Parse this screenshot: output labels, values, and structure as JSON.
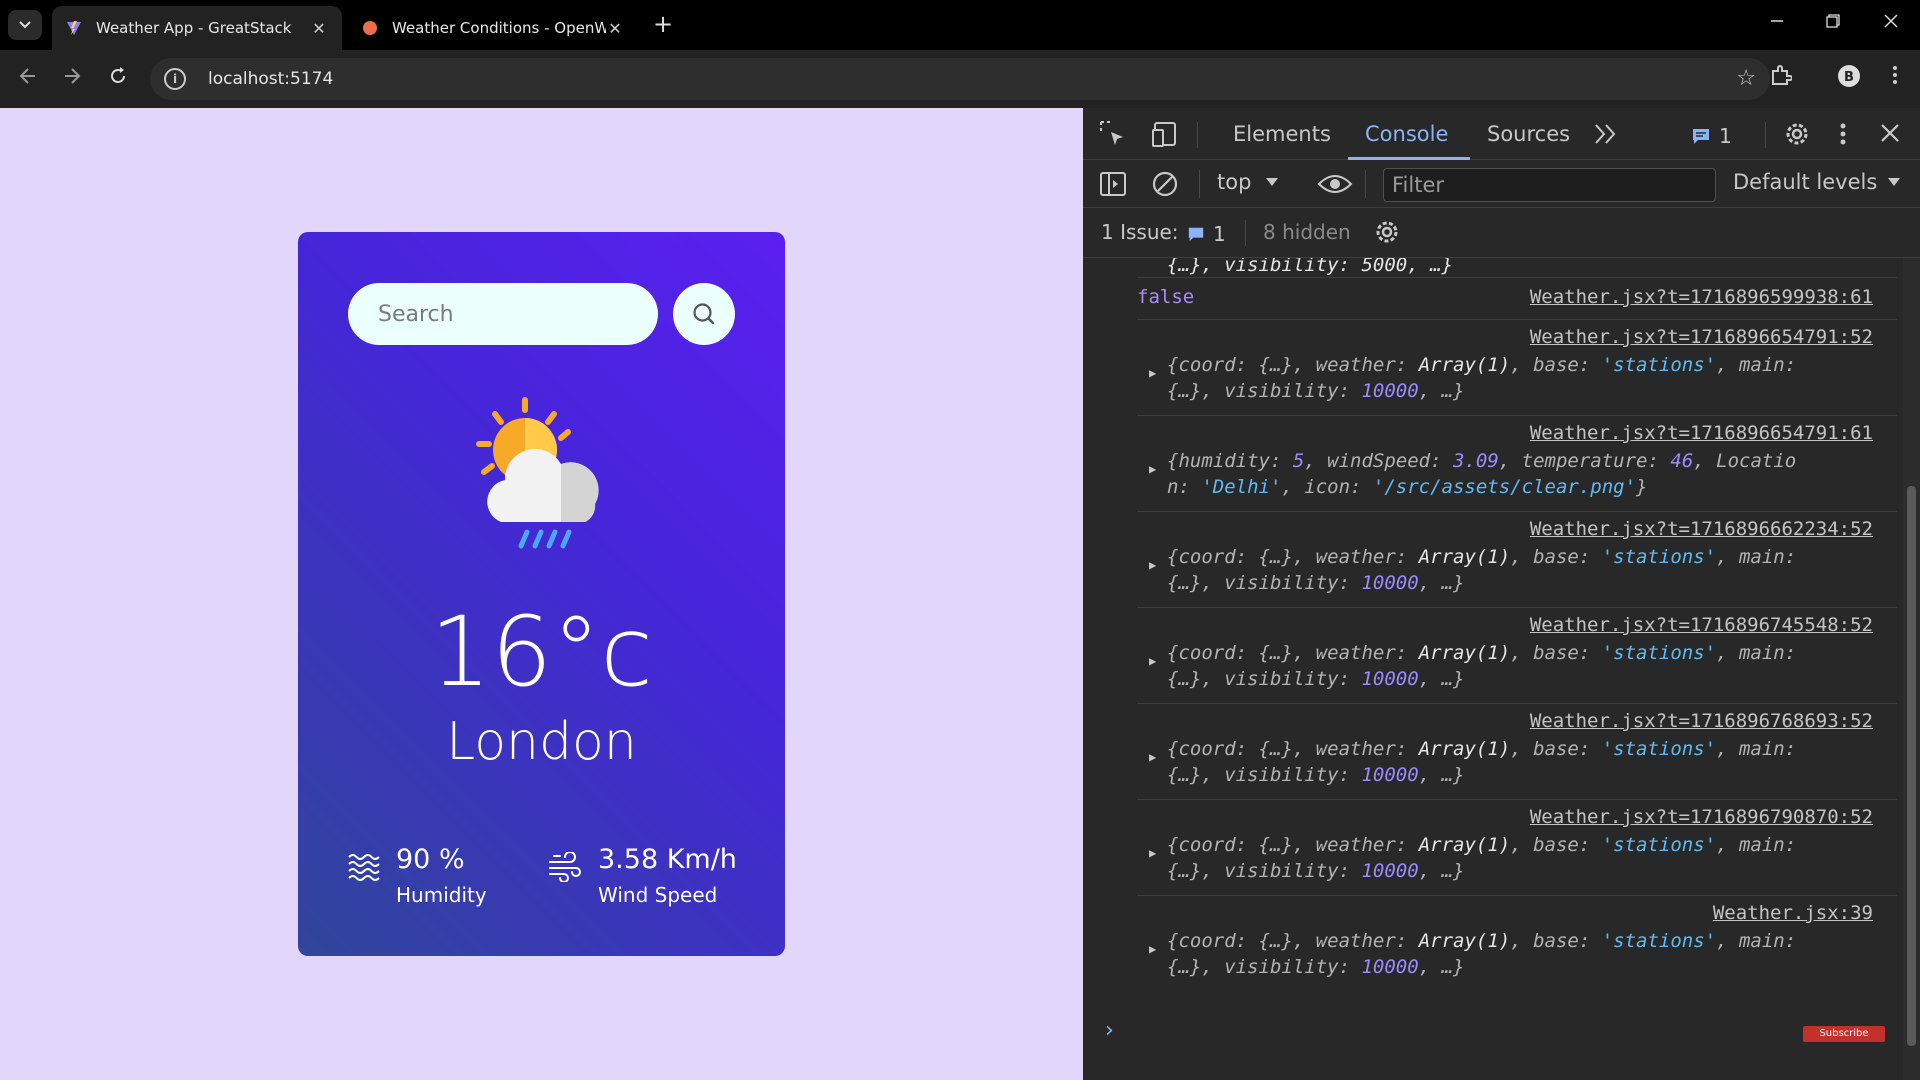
{
  "browser": {
    "tabs": [
      {
        "title": "Weather App - GreatStack",
        "active": true
      },
      {
        "title": "Weather Conditions - OpenWea",
        "active": false
      }
    ],
    "url": "localhost:5174",
    "tab_close": "✕",
    "new_tab": "+"
  },
  "app": {
    "search_placeholder": "Search",
    "temperature": "16°c",
    "city": "London",
    "humidity_value": "90 %",
    "humidity_label": "Humidity",
    "wind_value": "3.58 Km/h",
    "wind_label": "Wind Speed",
    "weather_icon": "partly-cloudy-rain-icon"
  },
  "devtools": {
    "tabs": [
      "Elements",
      "Console",
      "Sources"
    ],
    "active_tab": "Console",
    "messages_badge": "1",
    "context": "top",
    "filter_placeholder": "Filter",
    "levels": "Default levels",
    "issues_label": "1 Issue:",
    "issues_count": "1",
    "hidden_label": "8 hidden",
    "console": {
      "top_partial": "{…}, visibility: 5000, …}",
      "false_value": "false",
      "false_source": "Weather.jsx?t=1716896599938:61",
      "entries": [
        {
          "source": "Weather.jsx?t=1716896654791:52",
          "type": "obj"
        },
        {
          "source": "Weather.jsx?t=1716896654791:61",
          "type": "data"
        },
        {
          "source": "Weather.jsx?t=1716896662234:52",
          "type": "obj"
        },
        {
          "source": "Weather.jsx?t=1716896745548:52",
          "type": "obj"
        },
        {
          "source": "Weather.jsx?t=1716896768693:52",
          "type": "obj"
        },
        {
          "source": "Weather.jsx?t=1716896790870:52",
          "type": "obj"
        },
        {
          "source": "Weather.jsx:39",
          "type": "obj"
        }
      ],
      "obj_line1": {
        "k1": "{coord: ",
        "v1": "{…}",
        "k2": ", weather: ",
        "v2": "Array(1)",
        "k3": ", base: ",
        "v3": "'stations'",
        "k4": ", main:"
      },
      "obj_line2": {
        "v1": "{…}",
        "k2": ", visibility: ",
        "v2": "10000",
        "k3": ", …}"
      },
      "data_line1": {
        "k1": "{humidity: ",
        "v1": "5",
        "k2": ", windSpeed: ",
        "v2": "3.09",
        "k3": ", temperature: ",
        "v3": "46",
        "k4": ", Locatio"
      },
      "data_line2": {
        "k1": "n: ",
        "v1": "'Delhi'",
        "k2": ", icon: ",
        "v2": "'/src/assets/clear.png'",
        "k3": "}"
      },
      "prompt": "›"
    },
    "subscribe": "Subscribe"
  }
}
